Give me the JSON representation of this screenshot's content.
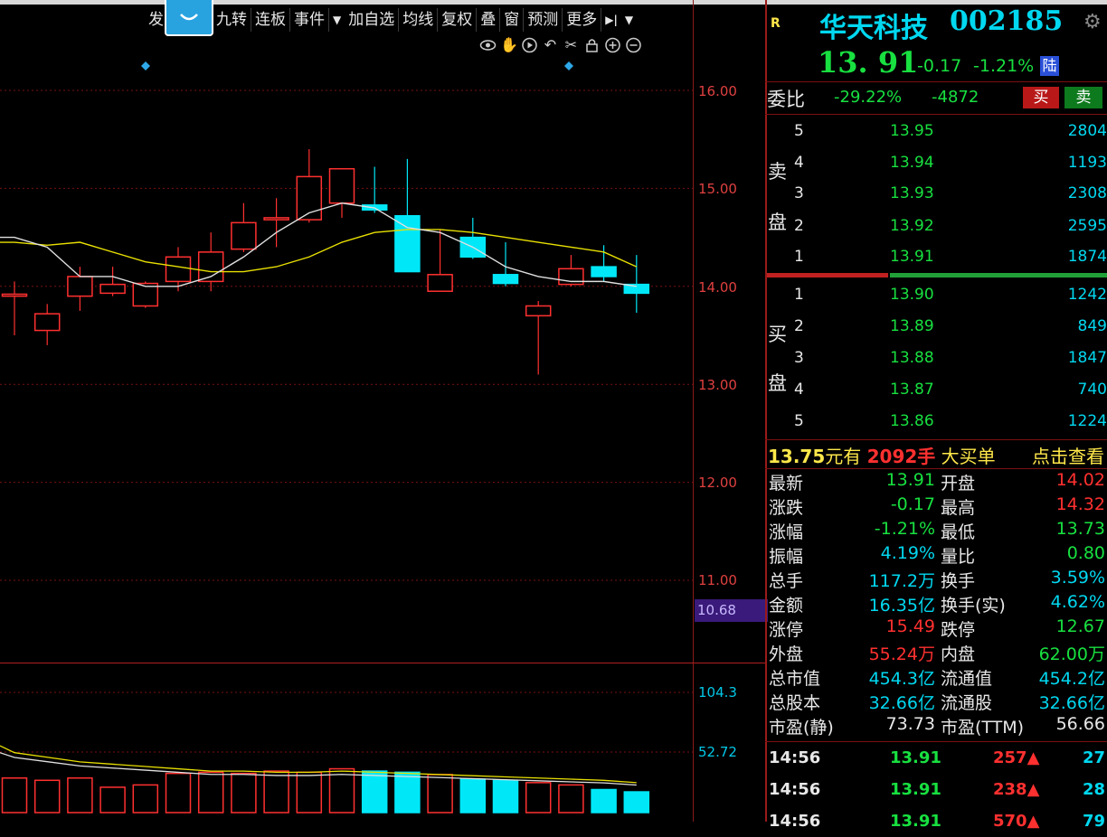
{
  "toolbar": {
    "items": [
      "发",
      "面",
      "九转",
      "连板",
      "事件",
      "加自选",
      "均线",
      "复权",
      "叠",
      "窗",
      "预测",
      "更多"
    ],
    "event_arrow": "▼",
    "more_arrow": "▼",
    "nav_icon": "▶|"
  },
  "chart_tools": [
    "eye-icon",
    "hand-icon",
    "play-icon",
    "undo-icon",
    "scissors-icon",
    "lock-icon",
    "zoom-in-icon",
    "zoom-out-icon"
  ],
  "price_axis": {
    "ticks": [
      "16.00",
      "15.00",
      "14.00",
      "13.00",
      "12.00",
      "11.00"
    ],
    "current_badge": "10.68"
  },
  "volume_axis": {
    "ticks": [
      "104.3",
      "52.72"
    ]
  },
  "chart_data": {
    "type": "candlestick",
    "ylim": [
      10.6,
      16.0
    ],
    "candles": [
      {
        "o": 13.9,
        "c": 13.92,
        "h": 14.05,
        "l": 13.5
      },
      {
        "o": 13.55,
        "c": 13.72,
        "h": 13.82,
        "l": 13.4
      },
      {
        "o": 13.9,
        "c": 14.1,
        "h": 14.2,
        "l": 13.75
      },
      {
        "o": 13.93,
        "c": 14.02,
        "h": 14.2,
        "l": 13.9
      },
      {
        "o": 13.8,
        "c": 14.03,
        "h": 14.05,
        "l": 13.78
      },
      {
        "o": 14.05,
        "c": 14.3,
        "h": 14.4,
        "l": 13.95
      },
      {
        "o": 14.05,
        "c": 14.35,
        "h": 14.55,
        "l": 13.95
      },
      {
        "o": 14.38,
        "c": 14.65,
        "h": 14.85,
        "l": 14.35
      },
      {
        "o": 14.68,
        "c": 14.7,
        "h": 14.9,
        "l": 14.4
      },
      {
        "o": 14.68,
        "c": 15.12,
        "h": 15.4,
        "l": 14.65
      },
      {
        "o": 14.85,
        "c": 15.2,
        "h": 15.2,
        "l": 14.7
      },
      {
        "o": 14.83,
        "c": 14.78,
        "h": 15.22,
        "l": 14.75
      },
      {
        "o": 14.72,
        "c": 14.15,
        "h": 15.3,
        "l": 14.15
      },
      {
        "o": 13.95,
        "c": 14.12,
        "h": 14.58,
        "l": 13.95
      },
      {
        "o": 14.5,
        "c": 14.3,
        "h": 14.7,
        "l": 14.28
      },
      {
        "o": 14.12,
        "c": 14.03,
        "h": 14.45,
        "l": 14.0
      },
      {
        "o": 13.7,
        "c": 13.8,
        "h": 13.85,
        "l": 13.1
      },
      {
        "o": 14.02,
        "c": 14.18,
        "h": 14.32,
        "l": 14.0
      },
      {
        "o": 14.2,
        "c": 14.1,
        "h": 14.42,
        "l": 14.05
      },
      {
        "o": 14.02,
        "c": 13.93,
        "h": 14.32,
        "l": 13.73
      }
    ],
    "ma_white": [
      14.5,
      14.4,
      14.1,
      14.1,
      14.0,
      14.0,
      14.1,
      14.3,
      14.55,
      14.75,
      14.85,
      14.8,
      14.6,
      14.55,
      14.4,
      14.2,
      14.1,
      14.05,
      14.05,
      14.0
    ],
    "ma_yellow": [
      14.45,
      14.42,
      14.45,
      14.35,
      14.25,
      14.2,
      14.15,
      14.15,
      14.2,
      14.3,
      14.45,
      14.55,
      14.58,
      14.58,
      14.55,
      14.5,
      14.45,
      14.4,
      14.35,
      14.2
    ],
    "volumes": [
      30,
      28,
      30,
      22,
      24,
      34,
      35,
      34,
      36,
      35,
      38,
      36,
      35,
      33,
      29,
      28,
      26,
      24,
      20,
      18
    ],
    "vol_ma": [
      52,
      48,
      44,
      42,
      40,
      38,
      36,
      36,
      35,
      35,
      36,
      35,
      34,
      33,
      32,
      31,
      30,
      29,
      28,
      26
    ]
  },
  "quote": {
    "tag": "R",
    "name": "华天科技",
    "code": "002185",
    "price": "13. 91",
    "change": "-0.17",
    "change_pct": "-1.21%",
    "connect_badge": "陆",
    "weibi_label": "委比",
    "weibi_pct": "-29.22%",
    "weibi_diff": "-4872",
    "buy_button": "买",
    "sell_button": "卖"
  },
  "orderbook": {
    "sell_label_1": "卖",
    "sell_label_2": "盘",
    "buy_label_1": "买",
    "buy_label_2": "盘",
    "sells": [
      {
        "level": "5",
        "price": "13.95",
        "volume": "2804"
      },
      {
        "level": "4",
        "price": "13.94",
        "volume": "1193"
      },
      {
        "level": "3",
        "price": "13.93",
        "volume": "2308"
      },
      {
        "level": "2",
        "price": "13.92",
        "volume": "2595"
      },
      {
        "level": "1",
        "price": "13.91",
        "volume": "1874"
      }
    ],
    "buys": [
      {
        "level": "1",
        "price": "13.90",
        "volume": "1242"
      },
      {
        "level": "2",
        "price": "13.89",
        "volume": "849"
      },
      {
        "level": "3",
        "price": "13.88",
        "volume": "1847"
      },
      {
        "level": "4",
        "price": "13.87",
        "volume": "740"
      },
      {
        "level": "5",
        "price": "13.86",
        "volume": "1224"
      }
    ]
  },
  "big_order": {
    "price": "13.75",
    "text1": "元有",
    "qty": "2092手",
    "text2": "大买单",
    "link": "点击查看"
  },
  "stats": [
    {
      "l1": "最新",
      "v1": "13.91",
      "c1": "green",
      "l2": "开盘",
      "v2": "14.02",
      "c2": "red"
    },
    {
      "l1": "涨跌",
      "v1": "-0.17",
      "c1": "green",
      "l2": "最高",
      "v2": "14.32",
      "c2": "red"
    },
    {
      "l1": "涨幅",
      "v1": "-1.21%",
      "c1": "green",
      "l2": "最低",
      "v2": "13.73",
      "c2": "green"
    },
    {
      "l1": "振幅",
      "v1": "4.19%",
      "c1": "cyan",
      "l2": "量比",
      "v2": "0.80",
      "c2": "green"
    },
    {
      "l1": "总手",
      "v1": "117.2万",
      "c1": "cyan",
      "l2": "换手",
      "v2": "3.59%",
      "c2": "cyan"
    },
    {
      "l1": "金额",
      "v1": "16.35亿",
      "c1": "cyan",
      "l2": "换手(实)",
      "v2": "4.62%",
      "c2": "cyan"
    },
    {
      "l1": "涨停",
      "v1": "15.49",
      "c1": "red",
      "l2": "跌停",
      "v2": "12.67",
      "c2": "green"
    },
    {
      "l1": "外盘",
      "v1": "55.24万",
      "c1": "red",
      "l2": "内盘",
      "v2": "62.00万",
      "c2": "green"
    },
    {
      "l1": "总市值",
      "v1": "454.3亿",
      "c1": "cyan",
      "l2": "流通值",
      "v2": "454.2亿",
      "c2": "cyan"
    },
    {
      "l1": "总股本",
      "v1": "32.66亿",
      "c1": "cyan",
      "l2": "流通股",
      "v2": "32.66亿",
      "c2": "cyan"
    },
    {
      "l1": "市盈(静)",
      "v1": "73.73",
      "c1": "white",
      "l2": "市盈(TTM)",
      "v2": "56.66",
      "c2": "white"
    }
  ],
  "ticks": [
    {
      "time": "14:56",
      "price": "13.91",
      "vol": "257",
      "arrow": "▲",
      "num": "27"
    },
    {
      "time": "14:56",
      "price": "13.91",
      "vol": "238",
      "arrow": "▲",
      "num": "28"
    },
    {
      "time": "14:56",
      "price": "13.91",
      "vol": "570",
      "arrow": "▲",
      "num": "79"
    }
  ],
  "colors": {
    "up": "#ff3030",
    "down": "#00e8f8",
    "ma_white": "#e0e0e0",
    "ma_yellow": "#e8e000",
    "grid": "#7a1010",
    "axis_text": "#e04040"
  }
}
